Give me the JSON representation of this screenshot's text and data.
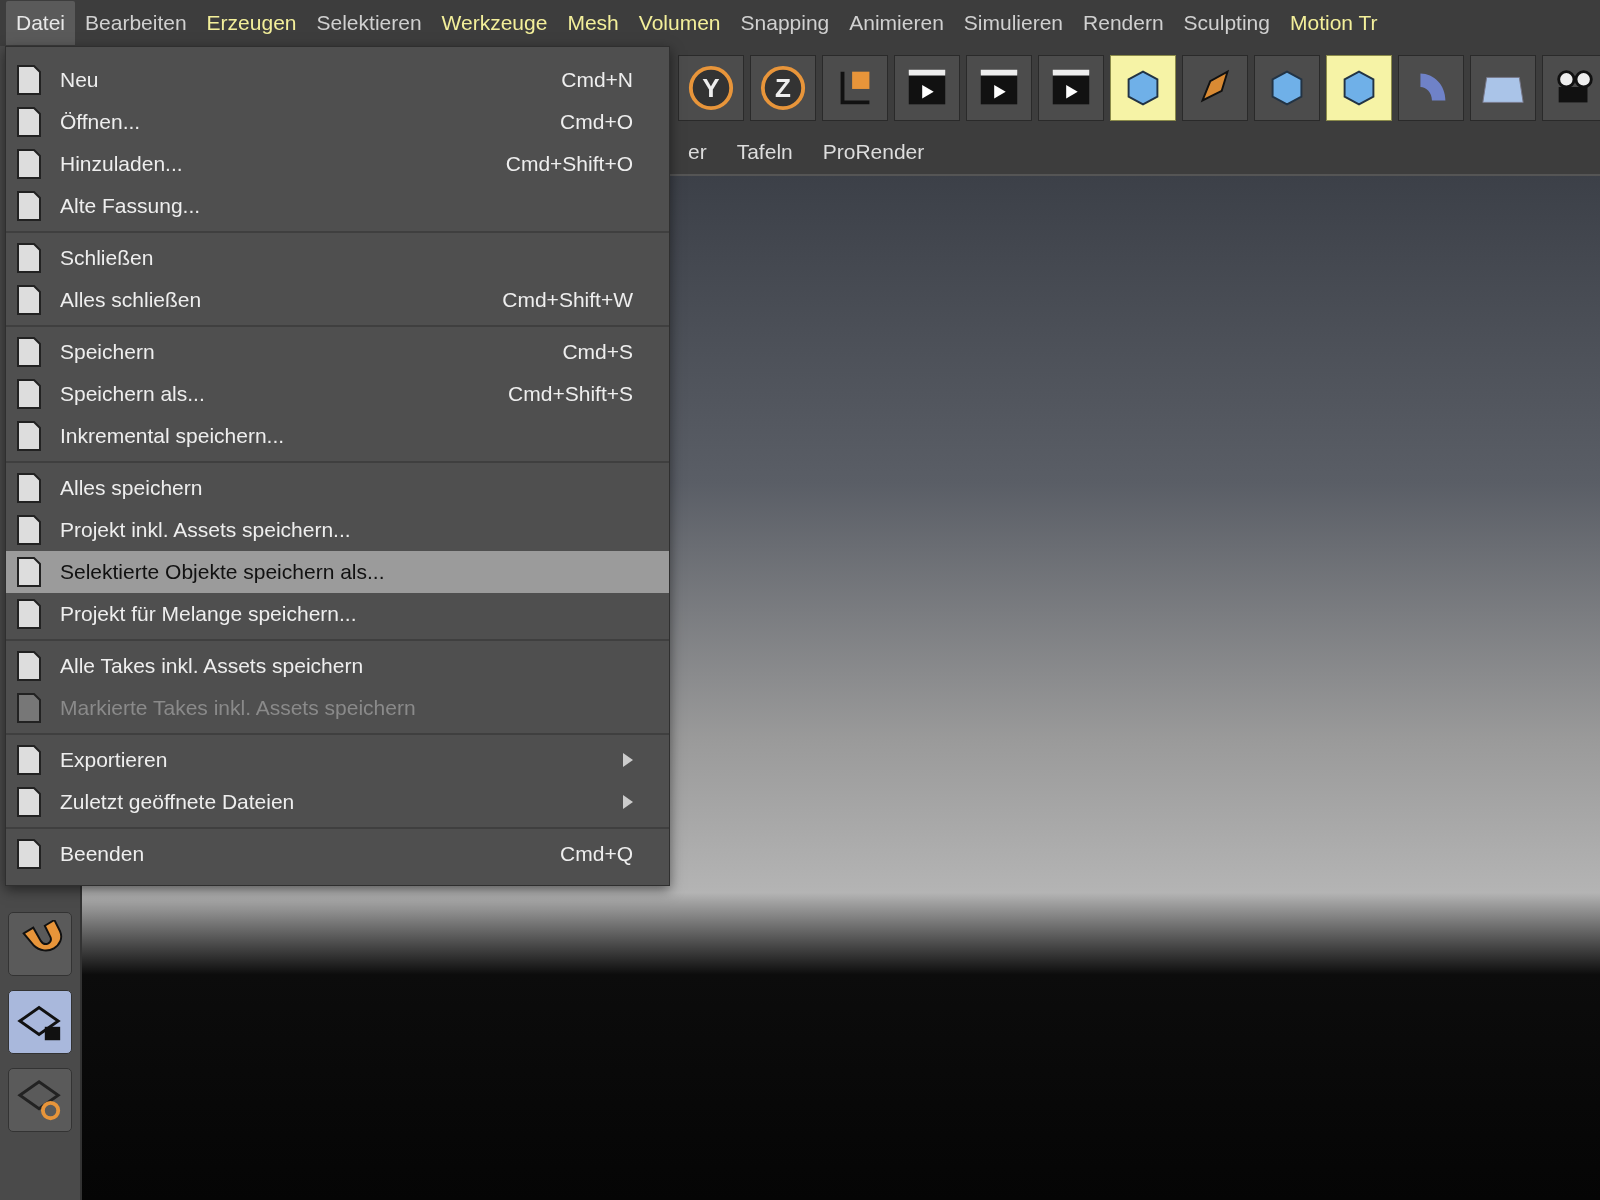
{
  "menubar": [
    {
      "label": "Datei",
      "selected": true,
      "color": "#e8e8e8"
    },
    {
      "label": "Bearbeiten",
      "selected": false,
      "color": "#d0d0d0"
    },
    {
      "label": "Erzeugen",
      "selected": false,
      "color": "#f3ef9a"
    },
    {
      "label": "Selektieren",
      "selected": false,
      "color": "#d0d0d0"
    },
    {
      "label": "Werkzeuge",
      "selected": false,
      "color": "#f3ef9a"
    },
    {
      "label": "Mesh",
      "selected": false,
      "color": "#f3ef9a"
    },
    {
      "label": "Volumen",
      "selected": false,
      "color": "#f3ef9a"
    },
    {
      "label": "Snapping",
      "selected": false,
      "color": "#d0d0d0"
    },
    {
      "label": "Animieren",
      "selected": false,
      "color": "#d0d0d0"
    },
    {
      "label": "Simulieren",
      "selected": false,
      "color": "#d0d0d0"
    },
    {
      "label": "Rendern",
      "selected": false,
      "color": "#d0d0d0"
    },
    {
      "label": "Sculpting",
      "selected": false,
      "color": "#d0d0d0"
    },
    {
      "label": "Motion Tr",
      "selected": false,
      "color": "#f3ef9a"
    }
  ],
  "toolbar": [
    {
      "kind": "axis",
      "label": "Y",
      "selected": false
    },
    {
      "kind": "axis",
      "label": "Z",
      "selected": false
    },
    {
      "kind": "coord",
      "selected": false
    },
    {
      "kind": "clap",
      "selected": false
    },
    {
      "kind": "clap",
      "selected": false
    },
    {
      "kind": "clap",
      "selected": false
    },
    {
      "kind": "cube",
      "selected": true
    },
    {
      "kind": "pen",
      "selected": false
    },
    {
      "kind": "cube",
      "selected": false
    },
    {
      "kind": "cube",
      "selected": true
    },
    {
      "kind": "bend",
      "selected": false
    },
    {
      "kind": "floor",
      "selected": false
    },
    {
      "kind": "camera",
      "selected": false
    }
  ],
  "tabs": [
    {
      "label": "er"
    },
    {
      "label": "Tafeln"
    },
    {
      "label": "ProRender"
    }
  ],
  "left_tools": [
    {
      "kind": "magnet",
      "selected": false
    },
    {
      "kind": "grid-lock",
      "selected": true
    },
    {
      "kind": "grid-rotate",
      "selected": false
    }
  ],
  "file_menu": [
    [
      {
        "label": "Neu",
        "shortcut": "Cmd+N",
        "disabled": false,
        "selected": false,
        "submenu": false
      },
      {
        "label": "Öffnen...",
        "shortcut": "Cmd+O",
        "disabled": false,
        "selected": false,
        "submenu": false
      },
      {
        "label": "Hinzuladen...",
        "shortcut": "Cmd+Shift+O",
        "disabled": false,
        "selected": false,
        "submenu": false
      },
      {
        "label": "Alte Fassung...",
        "disabled": false,
        "selected": false,
        "submenu": false
      }
    ],
    [
      {
        "label": "Schließen",
        "disabled": false,
        "selected": false,
        "submenu": false
      },
      {
        "label": "Alles schließen",
        "shortcut": "Cmd+Shift+W",
        "disabled": false,
        "selected": false,
        "submenu": false
      }
    ],
    [
      {
        "label": "Speichern",
        "shortcut": "Cmd+S",
        "disabled": false,
        "selected": false,
        "submenu": false
      },
      {
        "label": "Speichern als...",
        "shortcut": "Cmd+Shift+S",
        "disabled": false,
        "selected": false,
        "submenu": false
      },
      {
        "label": "Inkremental speichern...",
        "disabled": false,
        "selected": false,
        "submenu": false
      }
    ],
    [
      {
        "label": "Alles speichern",
        "disabled": false,
        "selected": false,
        "submenu": false
      },
      {
        "label": "Projekt inkl. Assets speichern...",
        "disabled": false,
        "selected": false,
        "submenu": false
      },
      {
        "label": "Selektierte Objekte speichern als...",
        "disabled": false,
        "selected": true,
        "submenu": false
      },
      {
        "label": "Projekt für Melange speichern...",
        "disabled": false,
        "selected": false,
        "submenu": false
      }
    ],
    [
      {
        "label": "Alle Takes inkl. Assets speichern",
        "disabled": false,
        "selected": false,
        "submenu": false
      },
      {
        "label": "Markierte Takes inkl. Assets speichern",
        "disabled": true,
        "selected": false,
        "submenu": false
      }
    ],
    [
      {
        "label": "Exportieren",
        "disabled": false,
        "selected": false,
        "submenu": true
      },
      {
        "label": "Zuletzt geöffnete Dateien",
        "disabled": false,
        "selected": false,
        "submenu": true
      }
    ],
    [
      {
        "label": "Beenden",
        "shortcut": "Cmd+Q",
        "disabled": false,
        "selected": false,
        "submenu": false
      }
    ]
  ]
}
